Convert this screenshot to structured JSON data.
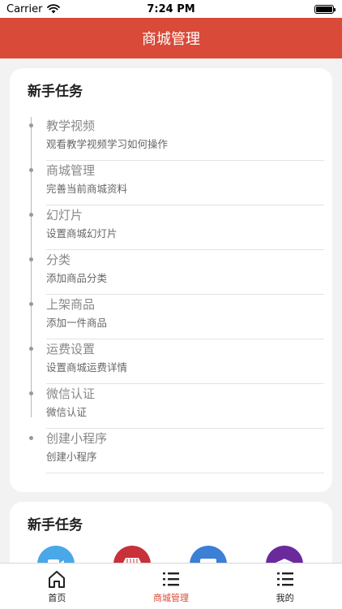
{
  "status_bar": {
    "carrier": "Carrier",
    "time": "7:24 PM"
  },
  "nav": {
    "title": "商城管理"
  },
  "tasks_card": {
    "title": "新手任务",
    "items": [
      {
        "name": "教学视频",
        "desc": "观看教学视频学习如何操作"
      },
      {
        "name": "商城管理",
        "desc": "完善当前商城资料"
      },
      {
        "name": "幻灯片",
        "desc": "设置商城幻灯片"
      },
      {
        "name": "分类",
        "desc": "添加商品分类"
      },
      {
        "name": "上架商品",
        "desc": "添加一件商品"
      },
      {
        "name": "运费设置",
        "desc": "设置商城运费详情"
      },
      {
        "name": "微信认证",
        "desc": "微信认证"
      },
      {
        "name": "创建小程序",
        "desc": "创建小程序"
      }
    ]
  },
  "second_card": {
    "title": "新手任务",
    "icons": [
      {
        "icon": "video-icon",
        "color": "#4aa8e8"
      },
      {
        "icon": "shop-icon",
        "color": "#c8313a"
      },
      {
        "icon": "slideshow-icon",
        "color": "#3b7fd6"
      },
      {
        "icon": "graduation-icon",
        "color": "#6a2a9c"
      }
    ]
  },
  "tab_bar": {
    "tabs": [
      {
        "label": "首页",
        "icon": "home-icon",
        "active": false
      },
      {
        "label": "商城管理",
        "icon": "list-icon",
        "active": true
      },
      {
        "label": "我的",
        "icon": "list-icon",
        "active": false
      }
    ],
    "active_color": "#d94a38"
  }
}
